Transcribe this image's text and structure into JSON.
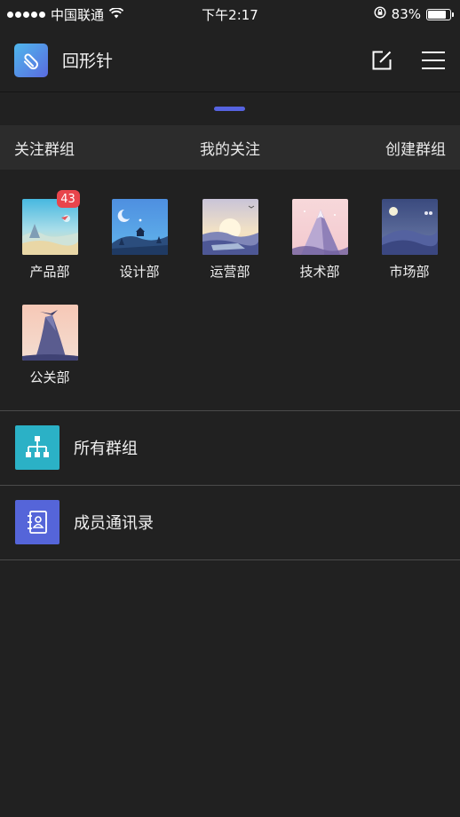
{
  "status_bar": {
    "carrier": "中国联通",
    "time": "下午2:17",
    "battery_percent": "83%",
    "battery_level": 0.83
  },
  "header": {
    "app_title": "回形针",
    "logo_icon": "paperclip-icon",
    "compose_icon": "compose-icon",
    "menu_icon": "hamburger-menu-icon"
  },
  "page_indicator": {
    "active_index": 0,
    "color": "#5663e0"
  },
  "section_bar": {
    "left_tab": "关注群组",
    "center_tab": "我的关注",
    "right_tab": "创建群组"
  },
  "groups": [
    {
      "label": "产品部",
      "badge": "43",
      "theme": "beach"
    },
    {
      "label": "设计部",
      "badge": "",
      "theme": "night-cabin"
    },
    {
      "label": "运营部",
      "badge": "",
      "theme": "sunset-lake"
    },
    {
      "label": "技术部",
      "badge": "",
      "theme": "pink-mountain"
    },
    {
      "label": "市场部",
      "badge": "",
      "theme": "moon-hills"
    },
    {
      "label": "公关部",
      "badge": "",
      "theme": "rock-peak"
    }
  ],
  "list": [
    {
      "label": "所有群组",
      "icon": "org-chart-icon",
      "color": "#2bb1c6"
    },
    {
      "label": "成员通讯录",
      "icon": "contacts-book-icon",
      "color": "#5565d9"
    }
  ],
  "colors": {
    "background": "#212121",
    "section_bar": "#2c2c2c",
    "badge": "#e8454c",
    "accent": "#5663e0"
  }
}
